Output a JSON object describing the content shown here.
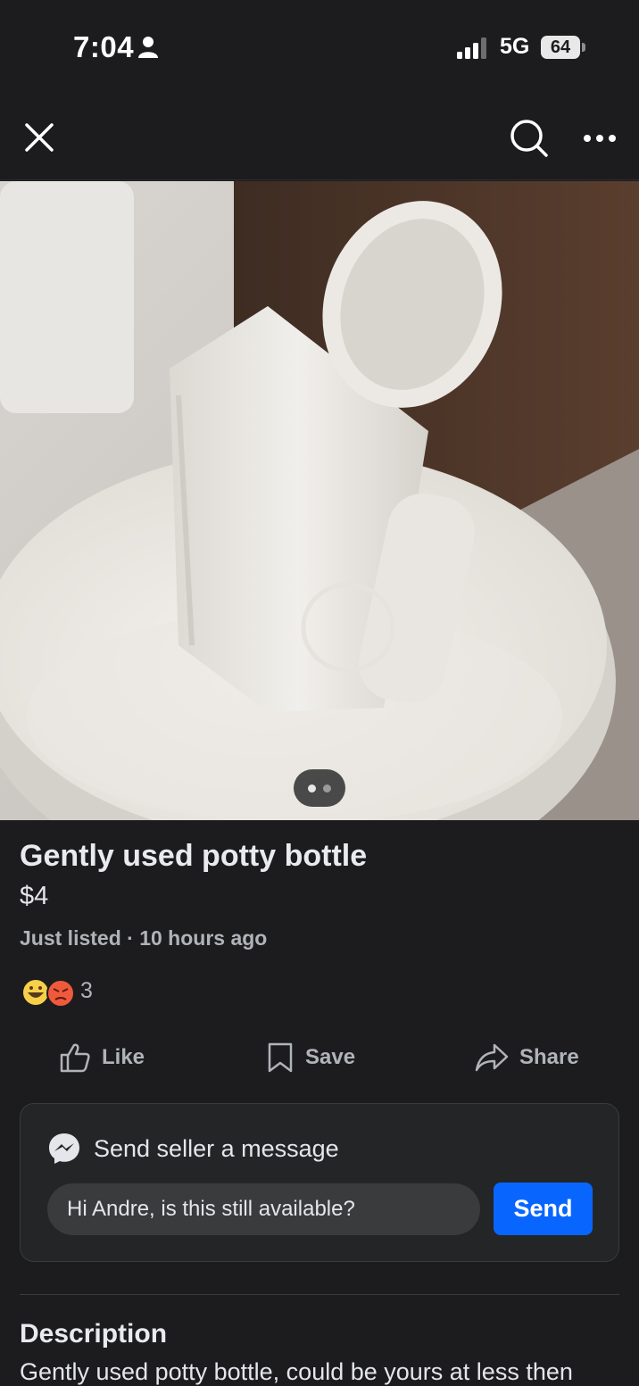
{
  "status_bar": {
    "time": "7:04",
    "network": "5G",
    "battery": "64"
  },
  "nav": {
    "close_icon": "close-icon",
    "search_icon": "search-icon",
    "more_icon": "more-icon"
  },
  "listing": {
    "title": "Gently used potty bottle",
    "price": "$4",
    "listed": "Just listed · 10 hours ago",
    "reaction_count": "3",
    "photo_pages": 2,
    "photo_current_page": 1
  },
  "actions": {
    "like": "Like",
    "save": "Save",
    "share": "Share"
  },
  "message": {
    "header": "Send seller a message",
    "input_value": "Hi Andre, is this still available?",
    "send_label": "Send"
  },
  "description": {
    "heading": "Description",
    "text": "Gently used potty bottle, could be yours at less then"
  },
  "colors": {
    "background": "#1c1c1e",
    "accent": "#0866ff"
  }
}
